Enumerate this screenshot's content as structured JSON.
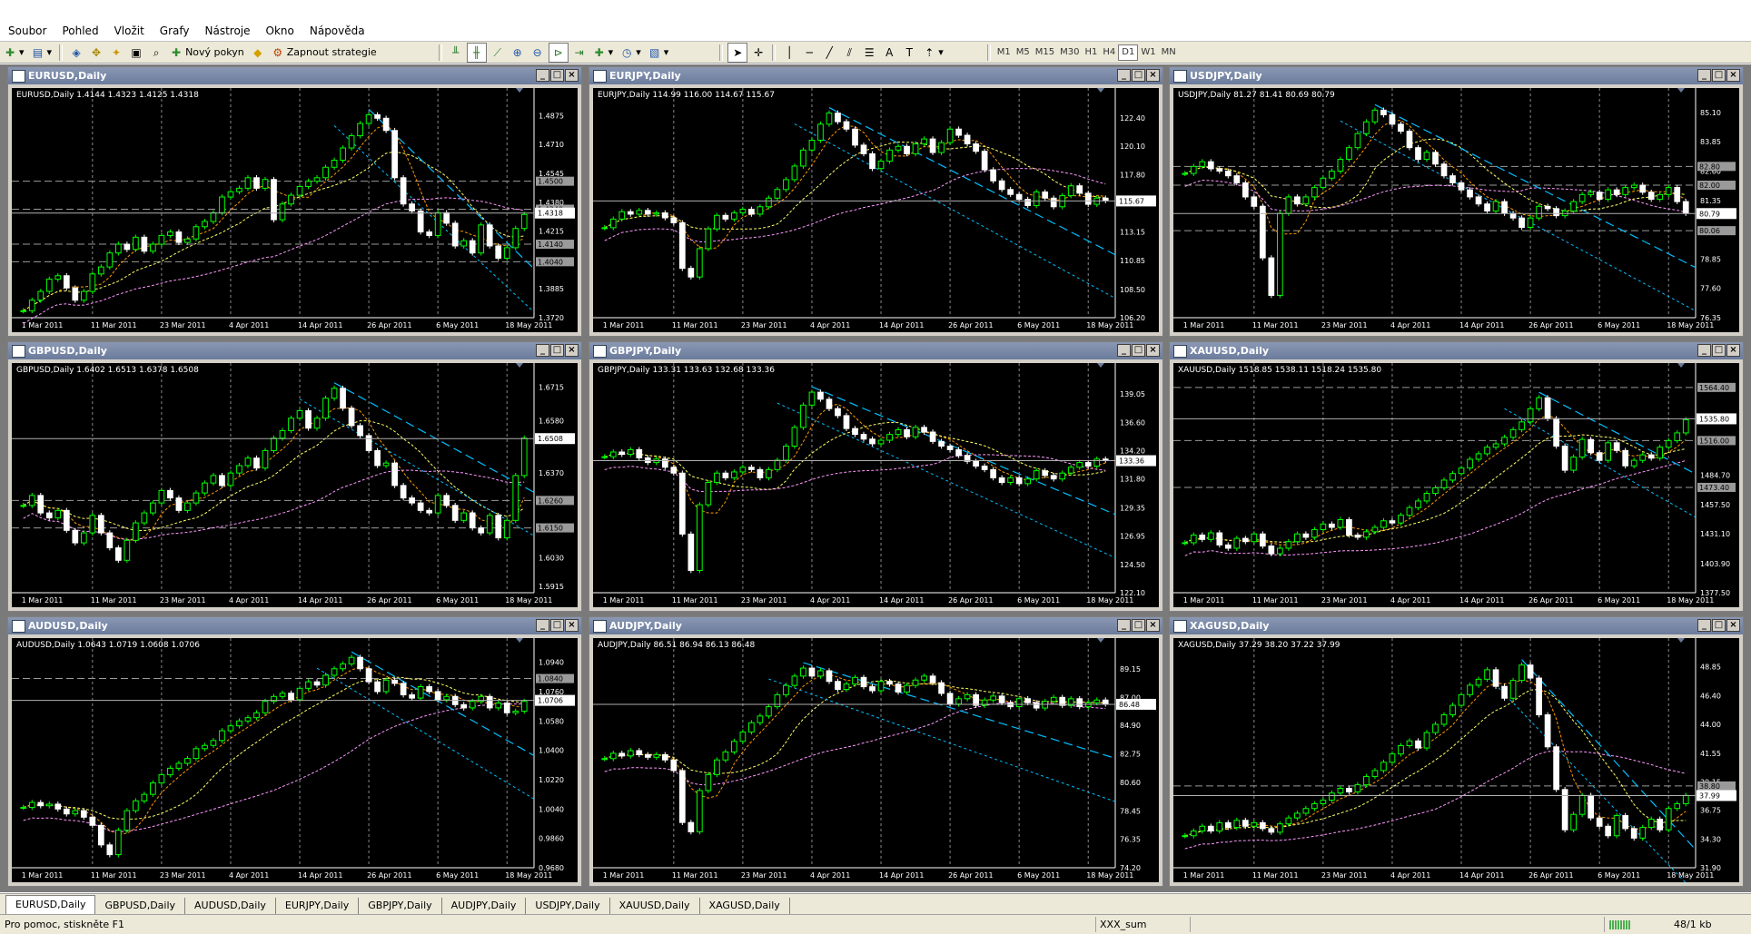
{
  "menu": [
    "Soubor",
    "Pohled",
    "Vložit",
    "Grafy",
    "Nástroje",
    "Okno",
    "Nápověda"
  ],
  "toolbar": {
    "new_order": "Nový pokyn",
    "autotrading": "Zapnout strategie",
    "timeframes": [
      "M1",
      "M5",
      "M15",
      "M30",
      "H1",
      "H4",
      "D1",
      "W1",
      "MN"
    ],
    "active_timeframe": "D1"
  },
  "x_ticks": [
    "1 Mar 2011",
    "11 Mar 2011",
    "23 Mar 2011",
    "4 Apr 2011",
    "14 Apr 2011",
    "26 Apr 2011",
    "6 May 2011",
    "18 May 2011"
  ],
  "colors": {
    "bull": "#00ff00",
    "bear": "#ffffff",
    "ma1": "#ff9900",
    "ma2": "#ffff66",
    "ma3": "#ff99ff",
    "trend": "#00bfff",
    "channel": "#ff2020",
    "grid": "#888888",
    "axis_text": "#ffffff"
  },
  "charts": [
    {
      "title": "EURUSD,Daily",
      "info": "EURUSD,Daily  1.4144 1.4323 1.4125 1.4318",
      "y_ticks": [
        "1.4875",
        "1.4710",
        "1.4545",
        "1.4380",
        "1.4215",
        "1.4050",
        "1.3885",
        "1.3720"
      ],
      "ymin": 1.372,
      "ymax": 1.496,
      "current": "1.4318",
      "levels": [
        "1.4500",
        "1.4340",
        "1.4140",
        "1.4040"
      ],
      "chart_data": {
        "type": "candlestick",
        "closes": [
          1.376,
          1.382,
          1.387,
          1.394,
          1.396,
          1.389,
          1.382,
          1.387,
          1.397,
          1.401,
          1.409,
          1.414,
          1.411,
          1.418,
          1.41,
          1.414,
          1.419,
          1.421,
          1.415,
          1.417,
          1.424,
          1.427,
          1.432,
          1.441,
          1.444,
          1.446,
          1.452,
          1.446,
          1.451,
          1.428,
          1.437,
          1.442,
          1.447,
          1.45,
          1.452,
          1.458,
          1.462,
          1.469,
          1.476,
          1.483,
          1.488,
          1.486,
          1.479,
          1.452,
          1.437,
          1.433,
          1.421,
          1.419,
          1.432,
          1.426,
          1.413,
          1.416,
          1.409,
          1.425,
          1.413,
          1.406,
          1.412,
          1.423,
          1.431
        ]
      }
    },
    {
      "title": "EURJPY,Daily",
      "info": "EURJPY,Daily  114.99 116.00 114.67 115.67",
      "y_ticks": [
        "122.40",
        "120.10",
        "117.80",
        "115.50",
        "113.15",
        "110.85",
        "108.50",
        "106.20"
      ],
      "ymin": 106.2,
      "ymax": 123.8,
      "current": "115.67",
      "levels": [],
      "chart_data": {
        "type": "candlestick",
        "closes": [
          113.5,
          114.2,
          114.8,
          114.6,
          114.9,
          114.6,
          114.7,
          114.3,
          113.9,
          110.2,
          109.5,
          111.8,
          113.4,
          114.5,
          114.2,
          114.7,
          115.0,
          114.6,
          115.2,
          115.9,
          116.6,
          117.4,
          118.5,
          119.8,
          120.6,
          121.9,
          122.8,
          122.1,
          121.5,
          120.2,
          119.5,
          118.3,
          118.9,
          119.8,
          120.1,
          119.5,
          120.3,
          120.7,
          119.6,
          120.4,
          121.5,
          121.0,
          120.3,
          119.7,
          118.2,
          117.3,
          116.6,
          116.2,
          115.8,
          115.3,
          116.4,
          115.9,
          115.2,
          116.1,
          116.9,
          116.3,
          115.4,
          115.9,
          115.7
        ]
      }
    },
    {
      "title": "USDJPY,Daily",
      "info": "USDJPY,Daily  81.27 81.41 80.69 80.79",
      "y_ticks": [
        "85.10",
        "83.85",
        "82.60",
        "81.35",
        "80.05",
        "78.85",
        "77.60",
        "76.35"
      ],
      "ymin": 76.35,
      "ymax": 85.6,
      "current": "80.79",
      "levels": [
        "82.80",
        "82.00",
        "80.06"
      ],
      "chart_data": {
        "type": "candlestick",
        "closes": [
          82.5,
          82.8,
          83.0,
          82.7,
          82.6,
          82.4,
          82.1,
          81.5,
          81.1,
          78.9,
          77.3,
          80.8,
          81.5,
          81.2,
          81.5,
          81.9,
          82.3,
          82.6,
          83.1,
          83.6,
          84.2,
          84.7,
          85.2,
          85.0,
          84.6,
          84.3,
          83.6,
          83.1,
          83.4,
          82.9,
          82.4,
          82.1,
          81.8,
          81.5,
          81.2,
          80.9,
          81.3,
          80.8,
          80.6,
          80.2,
          80.6,
          81.1,
          81.0,
          80.7,
          80.9,
          81.3,
          81.6,
          81.7,
          81.4,
          81.8,
          81.6,
          81.9,
          82.0,
          81.7,
          81.4,
          81.6,
          81.9,
          81.3,
          80.8
        ]
      }
    },
    {
      "title": "GBPUSD,Daily",
      "info": "GBPUSD,Daily  1.6402 1.6513 1.6378 1.6508",
      "y_ticks": [
        "1.6715",
        "1.6580",
        "1.6370",
        "1.6155",
        "1.6030",
        "1.5915"
      ],
      "ymin": 1.589,
      "ymax": 1.676,
      "current": "1.6508",
      "levels": [
        "1.6260",
        "1.6150"
      ],
      "chart_data": {
        "type": "candlestick",
        "closes": [
          1.624,
          1.628,
          1.621,
          1.619,
          1.622,
          1.614,
          1.609,
          1.613,
          1.62,
          1.613,
          1.607,
          1.602,
          1.61,
          1.617,
          1.621,
          1.625,
          1.63,
          1.627,
          1.622,
          1.625,
          1.629,
          1.633,
          1.636,
          1.632,
          1.637,
          1.64,
          1.643,
          1.639,
          1.646,
          1.651,
          1.654,
          1.659,
          1.662,
          1.655,
          1.659,
          1.667,
          1.671,
          1.663,
          1.656,
          1.652,
          1.646,
          1.64,
          1.641,
          1.632,
          1.627,
          1.625,
          1.622,
          1.621,
          1.628,
          1.624,
          1.618,
          1.621,
          1.615,
          1.613,
          1.62,
          1.611,
          1.618,
          1.636,
          1.651
        ]
      }
    },
    {
      "title": "GBPJPY,Daily",
      "info": "GBPJPY,Daily  133.31 133.63 132.68 133.36",
      "y_ticks": [
        "139.05",
        "136.60",
        "134.20",
        "131.80",
        "129.35",
        "126.95",
        "124.50",
        "122.10"
      ],
      "ymin": 122.1,
      "ymax": 140.6,
      "current": "133.36",
      "levels": [],
      "chart_data": {
        "type": "candlestick",
        "closes": [
          133.7,
          134.1,
          133.9,
          134.3,
          133.6,
          133.2,
          133.5,
          132.8,
          132.3,
          127.1,
          124.0,
          129.6,
          131.5,
          132.3,
          131.9,
          132.4,
          132.8,
          132.6,
          131.9,
          132.6,
          133.4,
          134.6,
          136.2,
          138.1,
          139.2,
          138.6,
          137.8,
          137.2,
          136.1,
          135.6,
          135.2,
          134.8,
          135.1,
          135.6,
          136.0,
          135.4,
          136.2,
          135.8,
          135.0,
          134.6,
          134.3,
          133.8,
          133.3,
          132.9,
          132.6,
          131.9,
          131.5,
          131.9,
          131.4,
          131.8,
          132.5,
          132.1,
          131.8,
          132.3,
          132.8,
          133.2,
          132.9,
          133.5,
          133.4
        ]
      }
    },
    {
      "title": "XAUUSD,Daily",
      "info": "XAUUSD,Daily  1518.85 1538.11 1518.24 1535.80",
      "y_ticks": [
        "1564.40",
        "1535.80",
        "1516.00",
        "1484.70",
        "1457.50",
        "1431.10",
        "1403.90",
        "1377.50"
      ],
      "ymin": 1377.5,
      "ymax": 1575.0,
      "current": "1535.80",
      "levels": [
        "1564.40",
        "1516.00",
        "1473.40"
      ],
      "chart_data": {
        "type": "candlestick",
        "closes": [
          1423,
          1430,
          1426,
          1432,
          1421,
          1418,
          1427,
          1424,
          1431,
          1420,
          1413,
          1418,
          1424,
          1431,
          1428,
          1435,
          1440,
          1437,
          1444,
          1430,
          1428,
          1433,
          1437,
          1443,
          1441,
          1448,
          1455,
          1461,
          1468,
          1473,
          1480,
          1486,
          1491,
          1499,
          1504,
          1510,
          1513,
          1519,
          1526,
          1533,
          1545,
          1555,
          1536,
          1511,
          1489,
          1501,
          1517,
          1505,
          1498,
          1514,
          1507,
          1493,
          1498,
          1503,
          1500,
          1510,
          1516,
          1523,
          1535
        ]
      }
    },
    {
      "title": "AUDUSD,Daily",
      "info": "AUDUSD,Daily  1.0643 1.0719 1.0608 1.0706",
      "y_ticks": [
        "1.0940",
        "1.0840",
        "1.0760",
        "1.0580",
        "1.0400",
        "1.0220",
        "1.0040",
        "0.9860",
        "0.9680"
      ],
      "ymin": 0.968,
      "ymax": 1.101,
      "current": "1.0706",
      "levels": [
        "1.0840"
      ],
      "chart_data": {
        "type": "candlestick",
        "closes": [
          1.005,
          1.008,
          1.006,
          1.007,
          1.004,
          1.001,
          1.003,
          0.999,
          0.994,
          0.982,
          0.976,
          0.991,
          1.003,
          1.009,
          1.013,
          1.02,
          1.025,
          1.029,
          1.032,
          1.035,
          1.041,
          1.043,
          1.046,
          1.052,
          1.055,
          1.058,
          1.06,
          1.063,
          1.07,
          1.073,
          1.075,
          1.071,
          1.078,
          1.082,
          1.08,
          1.086,
          1.09,
          1.093,
          1.097,
          1.09,
          1.082,
          1.076,
          1.083,
          1.081,
          1.074,
          1.072,
          1.079,
          1.076,
          1.071,
          1.073,
          1.068,
          1.066,
          1.07,
          1.073,
          1.066,
          1.069,
          1.063,
          1.064,
          1.07
        ]
      }
    },
    {
      "title": "AUDJPY,Daily",
      "info": "AUDJPY,Daily  86.51 86.94 86.13 86.48",
      "y_ticks": [
        "89.15",
        "87.00",
        "84.90",
        "82.75",
        "80.60",
        "78.45",
        "76.35",
        "74.20"
      ],
      "ymin": 74.2,
      "ymax": 90.5,
      "current": "86.48",
      "levels": [],
      "chart_data": {
        "type": "candlestick",
        "closes": [
          82.4,
          82.8,
          82.6,
          83.0,
          82.7,
          82.5,
          82.7,
          82.3,
          81.5,
          77.6,
          76.9,
          80.0,
          81.2,
          82.3,
          82.9,
          83.7,
          84.4,
          85.1,
          85.6,
          86.3,
          87.2,
          87.9,
          88.6,
          89.2,
          88.6,
          89.0,
          88.2,
          87.6,
          88.0,
          88.5,
          87.8,
          87.5,
          88.2,
          88.0,
          87.4,
          87.9,
          88.3,
          88.6,
          88.1,
          87.3,
          86.5,
          86.9,
          87.2,
          86.4,
          86.8,
          87.1,
          86.6,
          86.3,
          86.9,
          86.6,
          86.2,
          86.7,
          87.0,
          86.4,
          86.9,
          86.3,
          86.6,
          86.8,
          86.5
        ]
      }
    },
    {
      "title": "XAGUSD,Daily",
      "info": "XAGUSD,Daily  37.29 38.20 37.22 37.99",
      "y_ticks": [
        "48.85",
        "46.40",
        "44.00",
        "41.55",
        "39.15",
        "36.75",
        "34.30",
        "31.90"
      ],
      "ymin": 31.9,
      "ymax": 50.2,
      "current": "37.99",
      "levels": [
        "38.80"
      ],
      "chart_data": {
        "type": "candlestick",
        "closes": [
          34.6,
          35.0,
          35.4,
          35.0,
          35.7,
          35.3,
          35.9,
          35.4,
          35.7,
          35.2,
          34.9,
          35.6,
          36.1,
          36.5,
          36.9,
          37.3,
          37.6,
          38.2,
          38.6,
          38.3,
          38.9,
          39.6,
          40.1,
          40.8,
          41.5,
          42.2,
          42.6,
          42.0,
          43.3,
          44.0,
          44.8,
          45.6,
          46.5,
          47.3,
          47.8,
          48.6,
          47.2,
          46.2,
          47.7,
          49.0,
          47.9,
          44.8,
          42.1,
          38.5,
          35.1,
          36.4,
          38.0,
          36.1,
          35.4,
          34.6,
          36.3,
          35.2,
          34.4,
          35.3,
          36.0,
          35.1,
          36.9,
          37.3,
          38.0
        ]
      }
    }
  ],
  "tabs": [
    "EURUSD,Daily",
    "GBPUSD,Daily",
    "AUDUSD,Daily",
    "EURJPY,Daily",
    "GBPJPY,Daily",
    "AUDJPY,Daily",
    "USDJPY,Daily",
    "XAUUSD,Daily",
    "XAGUSD,Daily"
  ],
  "status": {
    "help": "Pro pomoc, stiskněte F1",
    "profile": "XXX_sum",
    "traffic": "48/1 kb"
  }
}
